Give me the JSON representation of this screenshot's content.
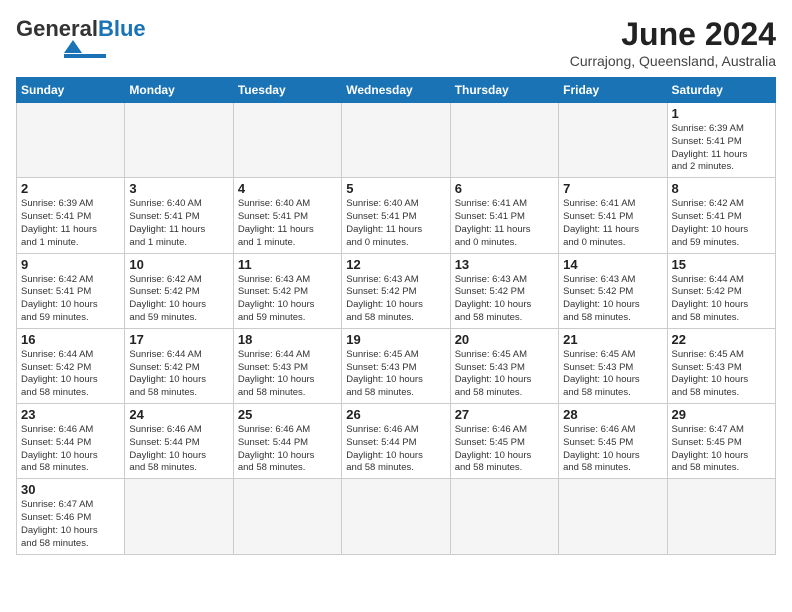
{
  "header": {
    "logo_general": "General",
    "logo_blue": "Blue",
    "month_year": "June 2024",
    "location": "Currajong, Queensland, Australia"
  },
  "weekdays": [
    "Sunday",
    "Monday",
    "Tuesday",
    "Wednesday",
    "Thursday",
    "Friday",
    "Saturday"
  ],
  "weeks": [
    [
      {
        "day": "",
        "info": ""
      },
      {
        "day": "",
        "info": ""
      },
      {
        "day": "",
        "info": ""
      },
      {
        "day": "",
        "info": ""
      },
      {
        "day": "",
        "info": ""
      },
      {
        "day": "",
        "info": ""
      },
      {
        "day": "1",
        "info": "Sunrise: 6:39 AM\nSunset: 5:41 PM\nDaylight: 11 hours\nand 2 minutes."
      }
    ],
    [
      {
        "day": "2",
        "info": "Sunrise: 6:39 AM\nSunset: 5:41 PM\nDaylight: 11 hours\nand 1 minute."
      },
      {
        "day": "3",
        "info": "Sunrise: 6:40 AM\nSunset: 5:41 PM\nDaylight: 11 hours\nand 1 minute."
      },
      {
        "day": "4",
        "info": "Sunrise: 6:40 AM\nSunset: 5:41 PM\nDaylight: 11 hours\nand 1 minute."
      },
      {
        "day": "5",
        "info": "Sunrise: 6:40 AM\nSunset: 5:41 PM\nDaylight: 11 hours\nand 0 minutes."
      },
      {
        "day": "6",
        "info": "Sunrise: 6:41 AM\nSunset: 5:41 PM\nDaylight: 11 hours\nand 0 minutes."
      },
      {
        "day": "7",
        "info": "Sunrise: 6:41 AM\nSunset: 5:41 PM\nDaylight: 11 hours\nand 0 minutes."
      },
      {
        "day": "8",
        "info": "Sunrise: 6:42 AM\nSunset: 5:41 PM\nDaylight: 10 hours\nand 59 minutes."
      }
    ],
    [
      {
        "day": "9",
        "info": "Sunrise: 6:42 AM\nSunset: 5:41 PM\nDaylight: 10 hours\nand 59 minutes."
      },
      {
        "day": "10",
        "info": "Sunrise: 6:42 AM\nSunset: 5:42 PM\nDaylight: 10 hours\nand 59 minutes."
      },
      {
        "day": "11",
        "info": "Sunrise: 6:43 AM\nSunset: 5:42 PM\nDaylight: 10 hours\nand 59 minutes."
      },
      {
        "day": "12",
        "info": "Sunrise: 6:43 AM\nSunset: 5:42 PM\nDaylight: 10 hours\nand 58 minutes."
      },
      {
        "day": "13",
        "info": "Sunrise: 6:43 AM\nSunset: 5:42 PM\nDaylight: 10 hours\nand 58 minutes."
      },
      {
        "day": "14",
        "info": "Sunrise: 6:43 AM\nSunset: 5:42 PM\nDaylight: 10 hours\nand 58 minutes."
      },
      {
        "day": "15",
        "info": "Sunrise: 6:44 AM\nSunset: 5:42 PM\nDaylight: 10 hours\nand 58 minutes."
      }
    ],
    [
      {
        "day": "16",
        "info": "Sunrise: 6:44 AM\nSunset: 5:42 PM\nDaylight: 10 hours\nand 58 minutes."
      },
      {
        "day": "17",
        "info": "Sunrise: 6:44 AM\nSunset: 5:42 PM\nDaylight: 10 hours\nand 58 minutes."
      },
      {
        "day": "18",
        "info": "Sunrise: 6:44 AM\nSunset: 5:43 PM\nDaylight: 10 hours\nand 58 minutes."
      },
      {
        "day": "19",
        "info": "Sunrise: 6:45 AM\nSunset: 5:43 PM\nDaylight: 10 hours\nand 58 minutes."
      },
      {
        "day": "20",
        "info": "Sunrise: 6:45 AM\nSunset: 5:43 PM\nDaylight: 10 hours\nand 58 minutes."
      },
      {
        "day": "21",
        "info": "Sunrise: 6:45 AM\nSunset: 5:43 PM\nDaylight: 10 hours\nand 58 minutes."
      },
      {
        "day": "22",
        "info": "Sunrise: 6:45 AM\nSunset: 5:43 PM\nDaylight: 10 hours\nand 58 minutes."
      }
    ],
    [
      {
        "day": "23",
        "info": "Sunrise: 6:46 AM\nSunset: 5:44 PM\nDaylight: 10 hours\nand 58 minutes."
      },
      {
        "day": "24",
        "info": "Sunrise: 6:46 AM\nSunset: 5:44 PM\nDaylight: 10 hours\nand 58 minutes."
      },
      {
        "day": "25",
        "info": "Sunrise: 6:46 AM\nSunset: 5:44 PM\nDaylight: 10 hours\nand 58 minutes."
      },
      {
        "day": "26",
        "info": "Sunrise: 6:46 AM\nSunset: 5:44 PM\nDaylight: 10 hours\nand 58 minutes."
      },
      {
        "day": "27",
        "info": "Sunrise: 6:46 AM\nSunset: 5:45 PM\nDaylight: 10 hours\nand 58 minutes."
      },
      {
        "day": "28",
        "info": "Sunrise: 6:46 AM\nSunset: 5:45 PM\nDaylight: 10 hours\nand 58 minutes."
      },
      {
        "day": "29",
        "info": "Sunrise: 6:47 AM\nSunset: 5:45 PM\nDaylight: 10 hours\nand 58 minutes."
      }
    ],
    [
      {
        "day": "30",
        "info": "Sunrise: 6:47 AM\nSunset: 5:46 PM\nDaylight: 10 hours\nand 58 minutes."
      },
      {
        "day": "",
        "info": ""
      },
      {
        "day": "",
        "info": ""
      },
      {
        "day": "",
        "info": ""
      },
      {
        "day": "",
        "info": ""
      },
      {
        "day": "",
        "info": ""
      },
      {
        "day": "",
        "info": ""
      }
    ]
  ]
}
